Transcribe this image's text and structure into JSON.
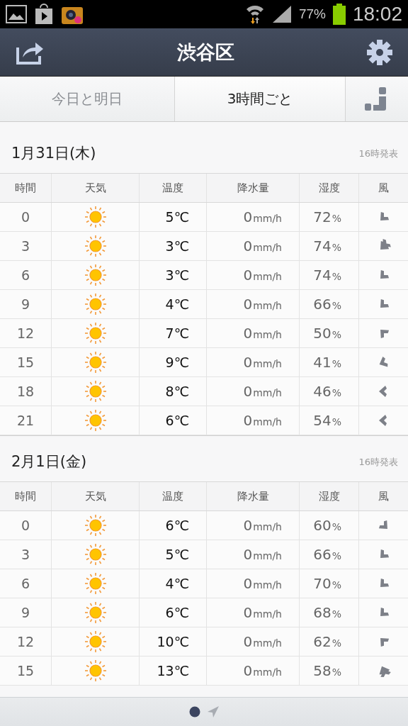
{
  "status_bar": {
    "battery": "77%",
    "time": "18:02"
  },
  "header": {
    "title": "渋谷区"
  },
  "tabs": [
    {
      "label": "今日と明日",
      "selected": false
    },
    {
      "label": "3時間ごと",
      "selected": true
    }
  ],
  "days": [
    {
      "date": "1月31日(木)",
      "issued": "16時発表",
      "columns": [
        "時間",
        "天気",
        "温度",
        "降水量",
        "湿度",
        "風"
      ],
      "rows": [
        {
          "time": "0",
          "temp": "5℃",
          "precip": "0",
          "precip_unit": "mm/h",
          "humidity": "72",
          "humidity_unit": "%",
          "wind": {
            "kind": "sw",
            "double": false
          }
        },
        {
          "time": "3",
          "temp": "3℃",
          "precip": "0",
          "precip_unit": "mm/h",
          "humidity": "74",
          "humidity_unit": "%",
          "wind": {
            "kind": "sw",
            "double": true
          }
        },
        {
          "time": "6",
          "temp": "3℃",
          "precip": "0",
          "precip_unit": "mm/h",
          "humidity": "74",
          "humidity_unit": "%",
          "wind": {
            "kind": "sw",
            "double": false
          }
        },
        {
          "time": "9",
          "temp": "4℃",
          "precip": "0",
          "precip_unit": "mm/h",
          "humidity": "66",
          "humidity_unit": "%",
          "wind": {
            "kind": "sw",
            "double": false
          }
        },
        {
          "time": "12",
          "temp": "7℃",
          "precip": "0",
          "precip_unit": "mm/h",
          "humidity": "50",
          "humidity_unit": "%",
          "wind": {
            "kind": "nw",
            "double": false
          }
        },
        {
          "time": "15",
          "temp": "9℃",
          "precip": "0",
          "precip_unit": "mm/h",
          "humidity": "41",
          "humidity_unit": "%",
          "wind": {
            "kind": "wsw",
            "double": false
          }
        },
        {
          "time": "18",
          "temp": "8℃",
          "precip": "0",
          "precip_unit": "mm/h",
          "humidity": "46",
          "humidity_unit": "%",
          "wind": {
            "kind": "w",
            "double": false
          }
        },
        {
          "time": "21",
          "temp": "6℃",
          "precip": "0",
          "precip_unit": "mm/h",
          "humidity": "54",
          "humidity_unit": "%",
          "wind": {
            "kind": "w",
            "double": false
          }
        }
      ]
    },
    {
      "date": "2月1日(金)",
      "issued": "16時発表",
      "columns": [
        "時間",
        "天気",
        "温度",
        "降水量",
        "湿度",
        "風"
      ],
      "rows": [
        {
          "time": "0",
          "temp": "6℃",
          "precip": "0",
          "precip_unit": "mm/h",
          "humidity": "60",
          "humidity_unit": "%",
          "wind": {
            "kind": "se",
            "double": false
          }
        },
        {
          "time": "3",
          "temp": "5℃",
          "precip": "0",
          "precip_unit": "mm/h",
          "humidity": "66",
          "humidity_unit": "%",
          "wind": {
            "kind": "sw",
            "double": false
          }
        },
        {
          "time": "6",
          "temp": "4℃",
          "precip": "0",
          "precip_unit": "mm/h",
          "humidity": "70",
          "humidity_unit": "%",
          "wind": {
            "kind": "sw",
            "double": false
          }
        },
        {
          "time": "9",
          "temp": "6℃",
          "precip": "0",
          "precip_unit": "mm/h",
          "humidity": "68",
          "humidity_unit": "%",
          "wind": {
            "kind": "sw",
            "double": false
          }
        },
        {
          "time": "12",
          "temp": "10℃",
          "precip": "0",
          "precip_unit": "mm/h",
          "humidity": "62",
          "humidity_unit": "%",
          "wind": {
            "kind": "nw",
            "double": false
          }
        },
        {
          "time": "15",
          "temp": "13℃",
          "precip": "0",
          "precip_unit": "mm/h",
          "humidity": "58",
          "humidity_unit": "%",
          "wind": {
            "kind": "nnw",
            "double": true
          }
        }
      ]
    }
  ],
  "pager": [
    {
      "kind": "dot",
      "selected": true
    },
    {
      "kind": "location",
      "selected": false
    }
  ]
}
